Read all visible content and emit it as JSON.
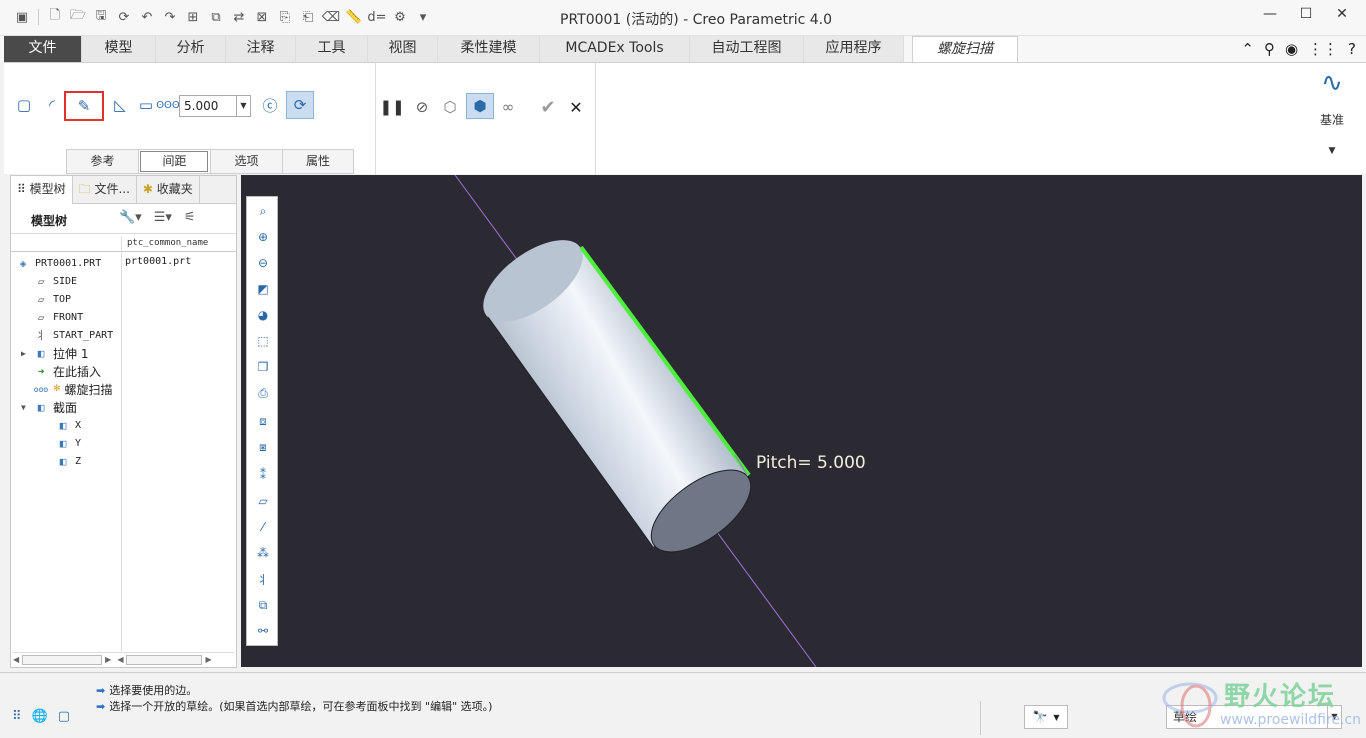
{
  "window": {
    "title": "PRT0001 (活动的) - Creo Parametric 4.0"
  },
  "ribbon_tabs": [
    {
      "label": "文件"
    },
    {
      "label": "模型"
    },
    {
      "label": "分析"
    },
    {
      "label": "注释"
    },
    {
      "label": "工具"
    },
    {
      "label": "视图"
    },
    {
      "label": "柔性建模"
    },
    {
      "label": "MCADEx Tools"
    },
    {
      "label": "自动工程图"
    },
    {
      "label": "应用程序"
    },
    {
      "label": "螺旋扫描"
    }
  ],
  "helix_sweep": {
    "pitch_value": "5.000",
    "panel_tabs": [
      {
        "label": "参考"
      },
      {
        "label": "间距"
      },
      {
        "label": "选项"
      },
      {
        "label": "属性"
      }
    ],
    "datum_label": "基准"
  },
  "navigator": {
    "tabs": [
      {
        "label": "模型树"
      },
      {
        "label": "文件..."
      },
      {
        "label": "收藏夹"
      }
    ],
    "tree_title": "模型树",
    "column_header": "ptc_common_name",
    "root_value": "prt0001.prt",
    "nodes": [
      {
        "label": "PRT0001.PRT"
      },
      {
        "label": "SIDE"
      },
      {
        "label": "TOP"
      },
      {
        "label": "FRONT"
      },
      {
        "label": "START_PART"
      },
      {
        "label": "拉伸 1"
      },
      {
        "label": "在此插入"
      },
      {
        "label": "螺旋扫描"
      },
      {
        "label": "截面"
      },
      {
        "label": "X"
      },
      {
        "label": "Y"
      },
      {
        "label": "Z"
      }
    ]
  },
  "graphics": {
    "pitch_label": "Pitch= 5.000",
    "background_color": "#2b2a33",
    "profile_edge_color": "#4cef3a",
    "axis_color": "#a26fd8"
  },
  "status": {
    "messages": [
      "选择要使用的边。",
      "选择一个开放的草绘。(如果首选内部草绘，可在参考面板中找到 \"编辑\" 选项。)"
    ],
    "filter_value": "草绘"
  },
  "watermark": {
    "cn": "野火论坛",
    "url": "www.proewildfire.cn"
  }
}
